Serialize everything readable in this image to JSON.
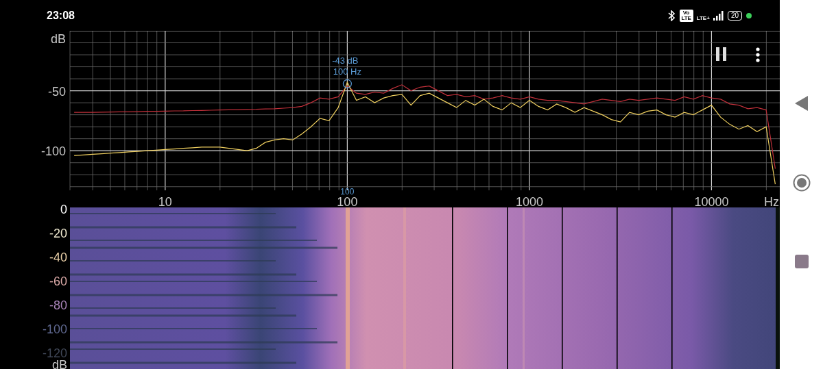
{
  "status_bar": {
    "time": "23:08",
    "volte": "Vo LTE",
    "network": "LTE+",
    "battery": "20"
  },
  "spectrum": {
    "peak": {
      "level": "-43 dB",
      "frequency": "100 Hz",
      "marker_label": "100"
    },
    "chart_data": {
      "type": "line",
      "xlabel": "Hz",
      "ylabel": "dB",
      "categories": [
        null,
        null,
        null,
        null,
        null,
        null,
        null,
        null,
        null,
        null,
        "10",
        null,
        null,
        null,
        null,
        null,
        null,
        null,
        null,
        null,
        null,
        null,
        null,
        null,
        null,
        null,
        null,
        null,
        null,
        null,
        "100",
        null,
        null,
        null,
        null,
        null,
        null,
        null,
        null,
        null,
        null,
        null,
        null,
        null,
        null,
        null,
        null,
        null,
        null,
        null,
        "1000",
        null,
        null,
        null,
        null,
        null,
        null,
        null,
        null,
        null,
        null,
        null,
        null,
        null,
        null,
        null,
        null,
        null,
        null,
        null,
        "10000",
        null,
        null,
        null,
        null,
        null,
        null,
        null
      ],
      "series": [
        {
          "color": "#c0303a",
          "values": [
            -68,
            -68,
            -68,
            -67.8,
            -67.7,
            -67.6,
            -67.5,
            -67.4,
            -67.2,
            -67.1,
            -67,
            -66.8,
            -66.7,
            -66.5,
            -66.4,
            -66.2,
            -66,
            -65.9,
            -65.8,
            -65.6,
            -65.5,
            -65.2,
            -65,
            -64.5,
            -64,
            -63,
            -60,
            -56,
            -57,
            -55,
            -46,
            -52,
            -53,
            -51,
            -52,
            -48,
            -45,
            -50,
            -47,
            -46,
            -50,
            -54,
            -53,
            -55,
            -54,
            -57,
            -56,
            -54,
            -56,
            -57,
            -55,
            -57,
            -58,
            -58,
            -59,
            -60,
            -61,
            -59,
            -57,
            -58,
            -59,
            -57,
            -58,
            -57,
            -56,
            -57,
            -58,
            -55,
            -57,
            -54,
            -56,
            -57,
            -61,
            -62,
            -65,
            -64,
            -66,
            -115
          ]
        },
        {
          "color": "#f0d060",
          "values": [
            -104,
            -103.5,
            -103,
            -102.5,
            -102,
            -101.5,
            -101,
            -100.5,
            -100,
            -99.5,
            -99,
            -98.5,
            -98,
            -97.5,
            -97,
            -97,
            -97,
            -98,
            -99,
            -100,
            -98,
            -93,
            -91,
            -90,
            -91,
            -86,
            -80,
            -73,
            -75,
            -64,
            -43,
            -58,
            -55,
            -60,
            -56,
            -54,
            -53,
            -62,
            -54,
            -52,
            -56,
            -60,
            -64,
            -58,
            -62,
            -57,
            -63,
            -66,
            -60,
            -64,
            -58,
            -63,
            -66,
            -61,
            -64,
            -68,
            -64,
            -67,
            -70,
            -74,
            -76,
            -68,
            -70,
            -67,
            -66,
            -70,
            -72,
            -68,
            -70,
            -66,
            -62,
            -72,
            -78,
            -82,
            -79,
            -84,
            -80,
            -128
          ]
        }
      ],
      "yticks": [
        {
          "value": -50,
          "label": "-50"
        },
        {
          "value": -100,
          "label": "-100"
        }
      ],
      "ylim": [
        -133,
        0
      ],
      "grid": true
    }
  },
  "spectrogram": {
    "labels": [
      {
        "text": "0",
        "color": "#ffffff"
      },
      {
        "text": "-20",
        "color": "#f0ead0"
      },
      {
        "text": "-40",
        "color": "#ead0a8"
      },
      {
        "text": "-60",
        "color": "#dcaaa8"
      },
      {
        "text": "-80",
        "color": "#a883b8"
      },
      {
        "text": "-100",
        "color": "#5f6890"
      },
      {
        "text": "-120",
        "color": "#3f4656"
      }
    ],
    "unit": "dB"
  }
}
